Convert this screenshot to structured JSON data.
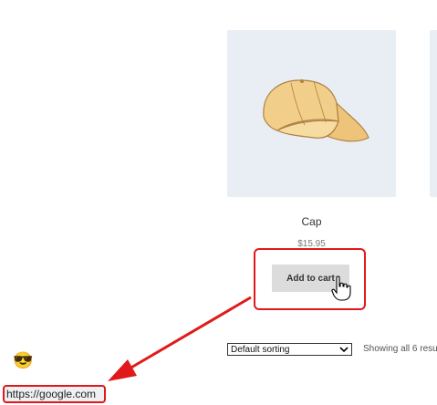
{
  "product": {
    "title": "Cap",
    "price": "$15.95",
    "add_to_cart_label": "Add to cart"
  },
  "shop": {
    "sorting_selected": "Default sorting",
    "results_count": "Showing all 6 resu"
  },
  "status_bar": {
    "url": "https://google.com"
  },
  "icons": [
    "cap-product-image",
    "hand-pointer-cursor-icon",
    "chevron-down-icon",
    "sunglasses-emoji-icon"
  ],
  "colors": {
    "annotation_red": "#e01a1a",
    "image_background": "#e8eef4",
    "button_background": "#dcdcdc"
  }
}
